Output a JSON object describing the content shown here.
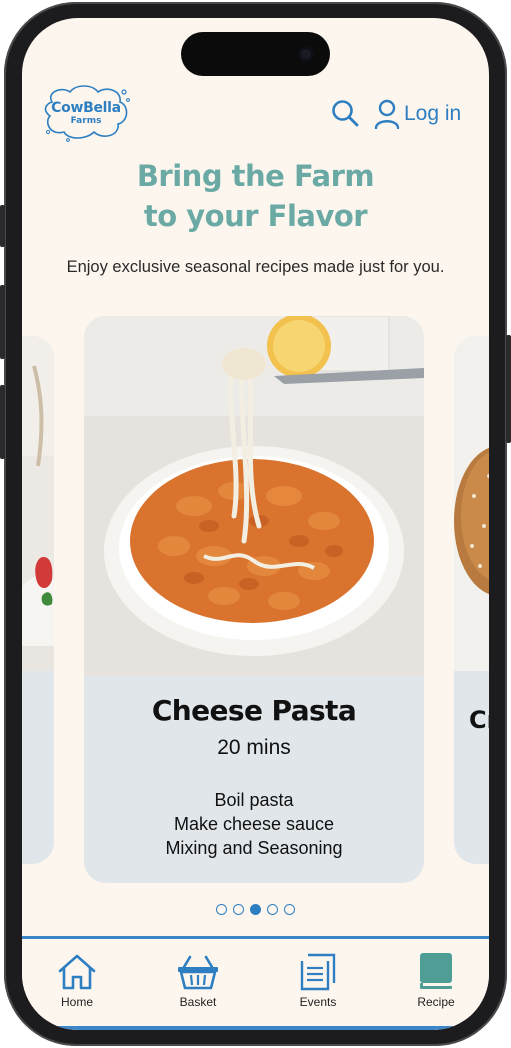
{
  "brand": {
    "name_line1": "CowBella",
    "name_line2": "Farms",
    "color": "#2d7fc1"
  },
  "header": {
    "search_icon": "search-icon",
    "login_icon": "user-icon",
    "login_label": "Log in"
  },
  "hero": {
    "headline_line1": "Bring the Farm",
    "headline_line2": "to your Flavor",
    "subtitle": "Enjoy exclusive seasonal recipes made just for you."
  },
  "carousel": {
    "current": {
      "title": "Cheese Pasta",
      "time": "20 mins",
      "steps": [
        "Boil pasta",
        "Make cheese sauce",
        "Mixing and Seasoning"
      ]
    },
    "next_peek_title": "Cr",
    "dot_count": 5,
    "active_dot": 3
  },
  "nav": {
    "items": [
      {
        "label": "Home",
        "icon": "home-icon"
      },
      {
        "label": "Basket",
        "icon": "basket-icon"
      },
      {
        "label": "Events",
        "icon": "events-document-icon"
      },
      {
        "label": "Recipe",
        "icon": "recipe-book-icon"
      }
    ]
  },
  "colors": {
    "accent": "#2d7fc1",
    "headline": "#6aa9a4",
    "background": "#fdf6ef",
    "card": "#e1e6ea"
  }
}
